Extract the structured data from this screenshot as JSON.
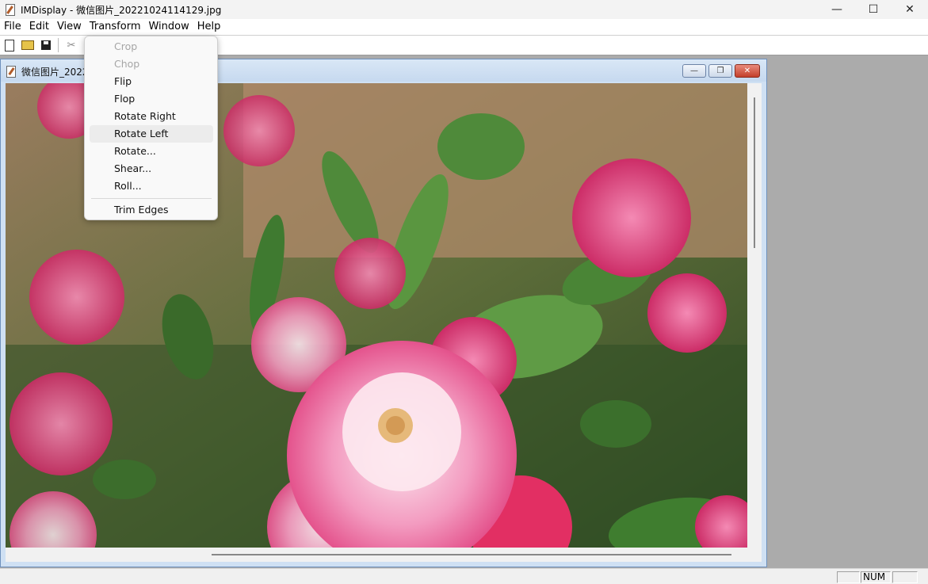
{
  "window": {
    "title": "IMDisplay - 微信图片_20221024114129.jpg",
    "controls": {
      "minimize": "—",
      "maximize": "☐",
      "close": "✕"
    }
  },
  "menubar": {
    "items": [
      {
        "label": "File"
      },
      {
        "label": "Edit"
      },
      {
        "label": "View"
      },
      {
        "label": "Transform"
      },
      {
        "label": "Window"
      },
      {
        "label": "Help"
      }
    ]
  },
  "toolbar": {
    "buttons": [
      "new-icon",
      "open-folder-icon",
      "save-icon",
      "cut-icon"
    ]
  },
  "transform_menu": {
    "items": [
      {
        "label": "Crop",
        "enabled": false
      },
      {
        "label": "Chop",
        "enabled": false
      },
      {
        "label": "Flip",
        "enabled": true
      },
      {
        "label": "Flop",
        "enabled": true
      },
      {
        "label": "Rotate Right",
        "enabled": true
      },
      {
        "label": "Rotate Left",
        "enabled": true,
        "highlighted": true
      },
      {
        "label": "Rotate...",
        "enabled": true
      },
      {
        "label": "Shear...",
        "enabled": true
      },
      {
        "label": "Roll...",
        "enabled": true
      },
      {
        "label": "Trim Edges",
        "enabled": true
      }
    ]
  },
  "child_window": {
    "title": "微信图片_2022",
    "image_name": "pink roses photo",
    "controls": {
      "minimize": "—",
      "restore": "❐",
      "close": "✕"
    }
  },
  "statusbar": {
    "num": "NUM"
  },
  "colors": {
    "accent_child_border": "#6f91bd",
    "close_red": "#c3402b",
    "rose_pink": "#e8508f",
    "leaf_green": "#4f8a3a",
    "soil_brown": "#b38a66"
  }
}
